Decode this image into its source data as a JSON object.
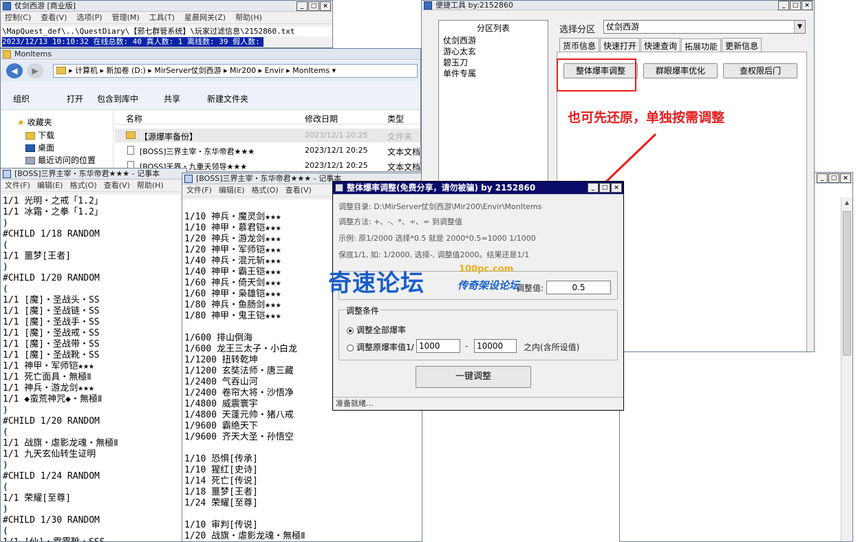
{
  "top_left_window": {
    "title": "仗剑西游 [商业版]",
    "menu": [
      "控制(C)",
      "查看(V)",
      "选项(P)",
      "管理(M)",
      "工具(T)",
      "星晨网关(Z)",
      "帮助(H)"
    ],
    "path_text": "\\MapQuest_def\\..\\QuestDiary\\【邪七群管系统】\\玩家过滤信息\\2152860.txt",
    "status_line": "2023/12/13 10:10:32 在线总数: 40 真人数: 1 离线数: 39 假人数: 0"
  },
  "explorer": {
    "title": "MonItems",
    "breadcrumb": [
      "计算机",
      "新加卷 (D:)",
      "MirServer仗剑西游",
      "Mir200",
      "Envir",
      "MonItems"
    ],
    "toolbar": [
      "组织",
      "打开",
      "包含到库中",
      "共享",
      "新建文件夹"
    ],
    "nav": {
      "favorites": "收藏夹",
      "items": [
        "下载",
        "桌面",
        "最近访问的位置"
      ]
    },
    "columns": {
      "name": "名称",
      "date": "修改日期",
      "type": "类型"
    },
    "files": [
      {
        "name": "【源爆率备份】",
        "date": "2023/12/1 20:25",
        "type": "文件夹"
      },
      {
        "name": "[BOSS]三界主宰・东华帝君★★★",
        "date": "2023/12/1 20:25",
        "type": "文本文档"
      },
      {
        "name": "[BOSS]天界・九重天领导★★★",
        "date": "2023/12/1 20:25",
        "type": "文本文档"
      }
    ]
  },
  "notepad1": {
    "title": "[BOSS]三界主宰・东华帝君★★★ - 记事本",
    "menu": [
      "文件(F)",
      "编辑(E)",
      "格式(O)",
      "查看(V)",
      "帮助(H)"
    ],
    "lines": [
      "1/1 光明・之戒「1.2」",
      "1/1 冰霜・之拳「1.2」",
      ")",
      "#CHILD 1/18 RANDOM",
      "(",
      "1/1 噩梦[王者]",
      ")",
      "#CHILD 1/20 RANDOM",
      "(",
      "1/1 [魔]・圣战头・SS",
      "1/1 [魔]・圣战链・SS",
      "1/1 [魔]・圣战手・SS",
      "1/1 [魔]・圣战戒・SS",
      "1/1 [魔]・圣战带・SS",
      "1/1 [魔]・圣战靴・SS",
      "1/1 神甲・军师铠★★★",
      "1/1 死亡面具・無極Ⅱ",
      "1/1 神兵・游龙剑★★★",
      "1/1 ◆蛮荒神咒◆・無極Ⅱ",
      ")",
      "#CHILD 1/20 RANDOM",
      "(",
      "1/1 战旗・虐影龙魂・無極Ⅱ",
      "1/1 九天玄仙转生证明",
      ")",
      "#CHILD 1/24 RANDOM",
      "(",
      "1/1 荣耀[至尊]",
      ")",
      "#CHILD 1/30 RANDOM",
      "(",
      "1/1 [仙]・霹雳靴・SSS"
    ]
  },
  "notepad2": {
    "title": "[BOSS]三界主宰・东华帝君★★★ - 记事本",
    "menu": [
      "文件(F)",
      "编辑(E)",
      "格式(O)",
      "查看(V)"
    ],
    "lines": [
      "",
      "1/10 神兵・魔灵剑★★★",
      "1/10 神甲・慕君铠★★★",
      "1/20 神兵・游龙剑★★★",
      "1/20 神甲・军师铠★★★",
      "1/40 神兵・混元斩★★★",
      "1/40 神甲・霸王铠★★★",
      "1/60 神兵・倚天剑★★★",
      "1/60 神甲・枭雄铠★★★",
      "1/80 神兵・鱼肠剑★★★",
      "1/80 神甲・鬼王铠★★★",
      "",
      "1/600 排山倒海",
      "1/600 龙王三太子・小白龙",
      "1/1200 扭转乾坤",
      "1/1200 玄奘法师・唐三藏",
      "1/2400 气吞山河",
      "1/2400 卷帘大将・沙悟净",
      "1/4800 威震寰宇",
      "1/4800 天蓬元帅・猪八戒",
      "1/9600 霸绝天下",
      "1/9600 齐天大圣・孙悟空",
      "",
      "1/10 恐惧[传承]",
      "1/10 猩红[史诗]",
      "1/14 死亡[传说]",
      "1/18 噩梦[王者]",
      "1/24 荣耀[至尊]",
      "",
      "1/10 审判[传说]",
      "1/20 战旗・虐影龙魂・無極Ⅱ"
    ]
  },
  "quicktool": {
    "title": "便捷工具   by:2152860",
    "zone_list_header": "分区列表",
    "zones": [
      "仗剑西游",
      "游心太玄",
      "碧玉刀",
      "单件专属"
    ],
    "select_label": "选择分区",
    "select_value": "仗剑西游",
    "tabs": [
      "货币信息",
      "快速打开",
      "快速查询",
      "拓展功能",
      "更新信息"
    ],
    "buttons": [
      "整体爆率调整",
      "群眼爆率优化",
      "查权限后门"
    ],
    "annotation": "也可先还原，单独按需调整"
  },
  "dialog": {
    "title": "整体爆率调整(免费分享，请勿被骗)    by 2152860",
    "dir_line": "调整目录: D:\\MirServer仗剑西游\\Mir200\\Envir\\MonItems",
    "method_line": "调整方法: +、-、*、÷、=  到调整值",
    "example_line": "示例: 原1/2000 选择*0.5 就是 2000*0.5=1000  1/1000",
    "note_line": "保底1/1, 如: 1/2000, 选择-, 调整值2000。结果还是1/1",
    "value_label": "调整值:",
    "value": "0.5",
    "conditions_title": "调整条件",
    "radio_all": "调整全部爆率",
    "radio_range_prefix": "调整原爆率值1/",
    "range_from": "1000",
    "range_sep": "-",
    "range_to": "10000",
    "range_suffix": "之内(含所设值)",
    "go_button": "一键调整",
    "status": "准备就绪..."
  },
  "watermark": {
    "main": "奇速论坛",
    "sub": "100pc.com",
    "tagline": "传奇架设论坛"
  },
  "colors": {
    "annotation": "#e81c1c",
    "watermark": "#1a5ec8",
    "status_highlight": "#0a24a8"
  }
}
